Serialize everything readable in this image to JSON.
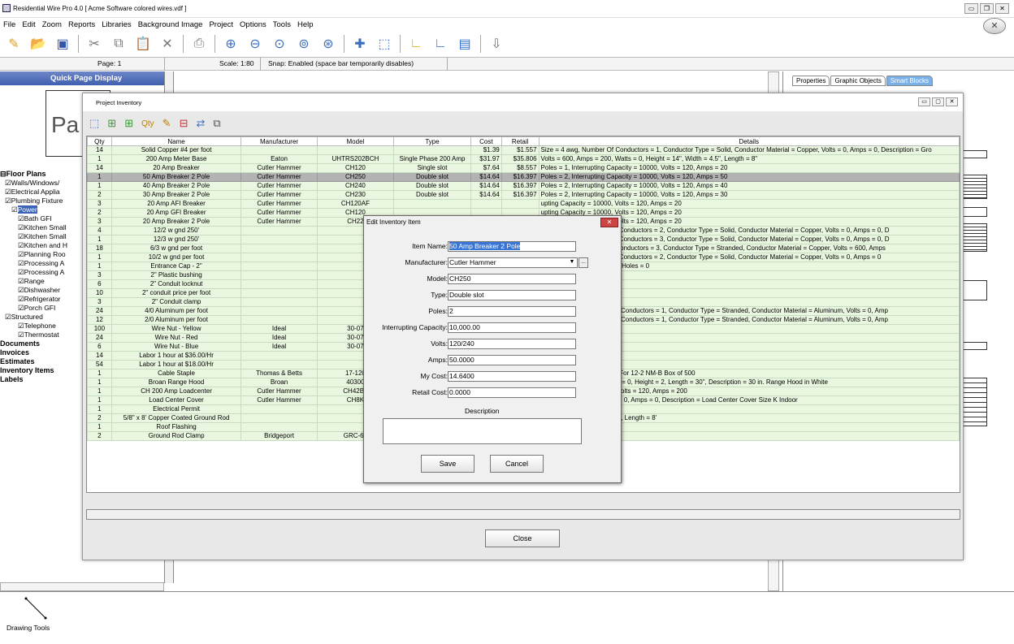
{
  "window": {
    "title": "Residential Wire Pro 4.0 [ Acme Software colored wires.vdf ]"
  },
  "menu": [
    "File",
    "Edit",
    "Zoom",
    "Reports",
    "Libraries",
    "Background Image",
    "Project",
    "Options",
    "Tools",
    "Help"
  ],
  "status": {
    "page": "Page: 1",
    "scale": "Scale: 1:80",
    "snap": "Snap: Enabled  (space bar temporarily disables)"
  },
  "left": {
    "quick_page_title": "Quick Page Display",
    "page_thumb": "Pa",
    "tree": [
      {
        "label": "Floor Plans",
        "kind": "root"
      },
      {
        "label": "Walls/Windows/",
        "kind": "c1"
      },
      {
        "label": "Electrical Applia",
        "kind": "c1"
      },
      {
        "label": "Plumbing Fixture",
        "kind": "c1"
      },
      {
        "label": "Power",
        "kind": "c1sel"
      },
      {
        "label": "Bath GFI",
        "kind": "c2"
      },
      {
        "label": "Kitchen Small",
        "kind": "c2"
      },
      {
        "label": "Kitchen Small",
        "kind": "c2"
      },
      {
        "label": "Kitchen and H",
        "kind": "c2"
      },
      {
        "label": "Planning Roo",
        "kind": "c2"
      },
      {
        "label": "Processing A",
        "kind": "c2"
      },
      {
        "label": "Processing A",
        "kind": "c2"
      },
      {
        "label": "Range",
        "kind": "c2"
      },
      {
        "label": "Dishwasher",
        "kind": "c2"
      },
      {
        "label": "Refrigerator",
        "kind": "c2"
      },
      {
        "label": "Porch GFI",
        "kind": "c2"
      },
      {
        "label": "Structured",
        "kind": "c1"
      },
      {
        "label": "Telephone",
        "kind": "c2"
      },
      {
        "label": "Thermostat",
        "kind": "c2"
      },
      {
        "label": "Documents",
        "kind": "root"
      },
      {
        "label": "Invoices",
        "kind": "root"
      },
      {
        "label": "Estimates",
        "kind": "root"
      },
      {
        "label": "Inventory Items",
        "kind": "root"
      },
      {
        "label": "Labels",
        "kind": "root"
      }
    ],
    "drawing_tools": "Drawing Tools"
  },
  "right_tabs": [
    "Properties",
    "Graphic Objects",
    "Smart Blocks"
  ],
  "inventory": {
    "title": "Project Inventory",
    "columns": [
      "Qty",
      "Name",
      "Manufacturer",
      "Model",
      "Type",
      "Cost",
      "Retail",
      "Details"
    ],
    "rows": [
      [
        "14",
        "Solid Copper #4 per foot",
        "",
        "",
        "",
        "$1.39",
        "$1.557",
        "Size = 4 awg, Number Of Conductors = 1, Conductor Type = Solid, Conductor Material = Copper, Volts = 0, Amps = 0, Description = Gro"
      ],
      [
        "1",
        "200 Amp Meter Base",
        "Eaton",
        "UHTRS202BCH",
        "Single Phase 200 Amp",
        "$31.97",
        "$35.806",
        "Volts = 600, Amps = 200, Watts = 0, Height = 14\", Width = 4.5\", Length = 8\""
      ],
      [
        "14",
        "20 Amp Breaker",
        "Cutler Hammer",
        "CH120",
        "Single slot",
        "$7.64",
        "$8.557",
        "Poles = 1, Interrupting Capacity = 10000, Volts = 120, Amps = 20"
      ],
      [
        "1",
        "50 Amp Breaker 2 Pole",
        "Cutler Hammer",
        "CH250",
        "Double slot",
        "$14.64",
        "$16.397",
        "Poles = 2, Interrupting Capacity = 10000, Volts = 120, Amps = 50"
      ],
      [
        "1",
        "40 Amp Breaker 2 Pole",
        "Cutler Hammer",
        "CH240",
        "Double slot",
        "$14.64",
        "$16.397",
        "Poles = 2, Interrupting Capacity = 10000, Volts = 120, Amps = 40"
      ],
      [
        "2",
        "30 Amp Breaker 2 Pole",
        "Cutler Hammer",
        "CH230",
        "Double slot",
        "$14.64",
        "$16.397",
        "Poles = 2, Interrupting Capacity = 10000, Volts = 120, Amps = 30"
      ],
      [
        "3",
        "20 Amp AFI Breaker",
        "Cutler Hammer",
        "CH120AF",
        "",
        "",
        "",
        "upting Capacity = 10000, Volts = 120, Amps = 20"
      ],
      [
        "2",
        "20 Amp GFI Breaker",
        "Cutler Hammer",
        "CH120",
        "",
        "",
        "",
        "upting Capacity = 10000, Volts = 120, Amps = 20"
      ],
      [
        "3",
        "20 Amp Breaker 2 Pole",
        "Cutler Hammer",
        "CH22",
        "",
        "",
        "",
        "upting Capacity = 10000, Volts = 120, Amps = 20"
      ],
      [
        "4",
        "12/2 w gnd 250'",
        "",
        "",
        "",
        "",
        "",
        "Size = 12 awg, Number Of Conductors = 2, Conductor Type = Solid, Conductor Material = Copper, Volts = 0, Amps = 0, D"
      ],
      [
        "1",
        "12/3 w gnd 250'",
        "",
        "",
        "",
        "",
        "",
        "Size = 12 awg, Number Of Conductors = 3, Conductor Type = Solid, Conductor Material = Copper, Volts = 0, Amps = 0, D"
      ],
      [
        "18",
        "6/3 w gnd per foot",
        "",
        "",
        "",
        "",
        "",
        "Size = 6 awg, Number Of Conductors = 3, Conductor Type = Stranded, Conductor Material = Copper, Volts = 600, Amps"
      ],
      [
        "1",
        "10/2 w gnd per foot",
        "",
        "",
        "",
        "",
        "",
        "Size = 10 awg, Number Of Conductors = 2, Conductor Type = Solid, Conductor Material = Copper, Volts = 0, Amps = 0"
      ],
      [
        "1",
        "Entrance Cap - 2\"",
        "",
        "",
        "",
        "",
        "",
        "inum, Size = 2\", Number Of Holes = 0"
      ],
      [
        "3",
        "2\" Plastic bushing",
        "",
        "",
        "",
        "",
        "",
        "ic, Size = 2\""
      ],
      [
        "6",
        "2\" Conduit locknut",
        "",
        "",
        "",
        "",
        "",
        ", Size = 2\""
      ],
      [
        "10",
        "2\" conduit price per foot",
        "",
        "",
        "",
        "",
        "",
        ", Size = 2\""
      ],
      [
        "3",
        "2\" Conduit clamp",
        "",
        "",
        "",
        "",
        "",
        "l, Size = 2\""
      ],
      [
        "24",
        "4/0 Aluminum per foot",
        "",
        "",
        "",
        "",
        "",
        "Size = 4/0  awg, Number Of Conductors = 1, Conductor Type = Stranded, Conductor Material = Aluminum, Volts = 0, Amp"
      ],
      [
        "12",
        "2/0 Aluminum per foot",
        "",
        "",
        "",
        "",
        "",
        "Size = 2/0 awg, Number Of Conductors = 1, Conductor Type = Stranded, Conductor Material = Aluminum, Volts = 0, Amp"
      ],
      [
        "100",
        "Wire Nut - Yellow",
        "Ideal",
        "30-07",
        "",
        "",
        "",
        "ach"
      ],
      [
        "24",
        "Wire Nut - Red",
        "Ideal",
        "30-07",
        "",
        "",
        "",
        "ach"
      ],
      [
        "6",
        "Wire Nut - Blue",
        "Ideal",
        "30-07",
        "",
        "",
        "",
        "ach"
      ],
      [
        "14",
        "Labor 1 hour at $36.00/Hr",
        "",
        "",
        "",
        "",
        "",
        "abor $36.00/Hr"
      ],
      [
        "54",
        "Labor 1 hour at $18.00/Hr",
        "",
        "",
        "",
        "",
        "",
        "abor $18.00/Hr"
      ],
      [
        "1",
        "Cable Staple",
        "Thomas & Betts",
        "17-120",
        "",
        "",
        "",
        ", Size = 1/2\", Description = For 12-2 NM-B  Box of 500"
      ],
      [
        "1",
        "Broan Range Hood",
        "Broan",
        "40300",
        "",
        "",
        "",
        "olts = 120, Amps = 0, Watts = 0, Height = 2, Length = 30\", Description = 30 in. Range Hood in White"
      ],
      [
        "1",
        "CH 200 Amp Loadcenter",
        "Cutler Hammer",
        "CH42B2",
        "",
        "",
        "",
        "rupting Capacity = 10000, Volts = 120, Amps = 200"
      ],
      [
        "1",
        "Load Center Cover",
        "Cutler Hammer",
        "CH8K",
        "",
        "",
        "",
        "rupting Capacity = 0, Volts = 0, Amps = 0, Description = Load Center Cover Size K Indoor"
      ],
      [
        "1",
        "Electrical Permit",
        "",
        "",
        "",
        "",
        "",
        "r Acme"
      ],
      [
        "2",
        "5/8\" x 8'  Copper Coated Ground Rod",
        "",
        "",
        "",
        "",
        "",
        "er Coated Steel, Size = 5/8\", Length = 8'"
      ],
      [
        "1",
        "Roof Flashing",
        "",
        "",
        "",
        "",
        "",
        "anized, Size = 2\""
      ],
      [
        "2",
        "Ground Rod Clamp",
        "Bridgeport",
        "GRC-63",
        "Direct Burial",
        "$3.77",
        "$4.222",
        "Size = 5/8\""
      ]
    ],
    "selected_row": 3,
    "close_label": "Close"
  },
  "edit": {
    "title": "Edit Inventory Item",
    "fields": [
      {
        "label": "Item Name:",
        "value": "50 Amp Breaker 2 Pole"
      },
      {
        "label": "Manufacturer:",
        "value": "Cutler Hammer"
      },
      {
        "label": "Model:",
        "value": "CH250"
      },
      {
        "label": "Type:",
        "value": "Double slot"
      },
      {
        "label": "Poles:",
        "value": "2"
      },
      {
        "label": "Interrupting Capacity:",
        "value": "10,000.00"
      },
      {
        "label": "Volts:",
        "value": "120/240"
      },
      {
        "label": "Amps:",
        "value": "50.0000"
      },
      {
        "label": "My Cost:",
        "value": "14.6400"
      },
      {
        "label": "Retail Cost:",
        "value": "0.0000"
      }
    ],
    "description_label": "Description",
    "save_label": "Save",
    "cancel_label": "Cancel"
  }
}
